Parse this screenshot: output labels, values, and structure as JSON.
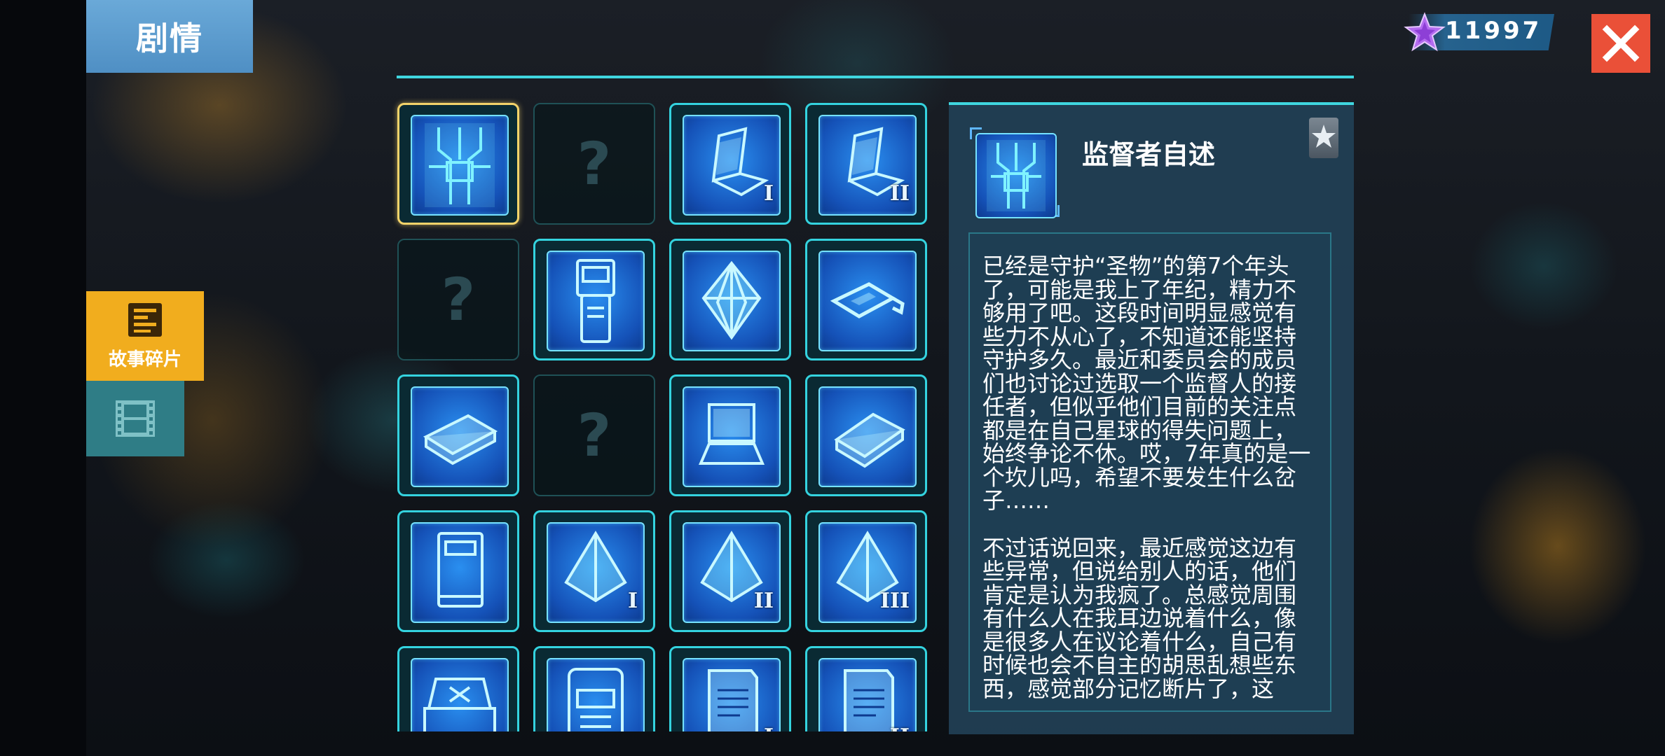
{
  "header": {
    "title": "剧情"
  },
  "sidebar": {
    "tabs": [
      {
        "label": "故事碎片",
        "icon": "document-list-icon",
        "active": true
      },
      {
        "label": "",
        "icon": "film-strip-icon",
        "active": false
      }
    ]
  },
  "currency": {
    "icon": "purple-star-icon",
    "value": "11997"
  },
  "close_button": {
    "icon": "close-icon"
  },
  "grid": {
    "items": [
      {
        "icon": "circuit-board-icon",
        "state": "selected",
        "numeral": ""
      },
      {
        "icon": "question-mark",
        "state": "locked",
        "numeral": "",
        "text": "?"
      },
      {
        "icon": "laptop-open-icon",
        "state": "unlocked",
        "numeral": "I"
      },
      {
        "icon": "laptop-open-icon",
        "state": "unlocked",
        "numeral": "II"
      },
      {
        "icon": "question-mark",
        "state": "locked",
        "numeral": "",
        "text": "?"
      },
      {
        "icon": "handheld-device-icon",
        "state": "unlocked",
        "numeral": ""
      },
      {
        "icon": "octahedron-crystal-icon",
        "state": "unlocked",
        "numeral": ""
      },
      {
        "icon": "usb-drive-icon",
        "state": "unlocked",
        "numeral": ""
      },
      {
        "icon": "book-icon",
        "state": "unlocked",
        "numeral": ""
      },
      {
        "icon": "question-mark",
        "state": "locked",
        "numeral": "",
        "text": "?"
      },
      {
        "icon": "laptop-icon",
        "state": "unlocked",
        "numeral": ""
      },
      {
        "icon": "tablet-device-icon",
        "state": "unlocked",
        "numeral": ""
      },
      {
        "icon": "notebook-icon",
        "state": "unlocked",
        "numeral": ""
      },
      {
        "icon": "pyramid-crystal-icon",
        "state": "unlocked",
        "numeral": "I"
      },
      {
        "icon": "pyramid-crystal-icon",
        "state": "unlocked",
        "numeral": "II"
      },
      {
        "icon": "pyramid-crystal-icon",
        "state": "unlocked",
        "numeral": "III"
      },
      {
        "icon": "console-device-icon",
        "state": "unlocked",
        "numeral": ""
      },
      {
        "icon": "robot-terminal-icon",
        "state": "unlocked",
        "numeral": ""
      },
      {
        "icon": "paper-document-icon",
        "state": "unlocked",
        "numeral": "I"
      },
      {
        "icon": "paper-document-icon",
        "state": "unlocked",
        "numeral": "II"
      }
    ]
  },
  "detail": {
    "icon": "circuit-board-icon",
    "badge_icon": "star-badge-icon",
    "title": "监督者自述",
    "paragraphs": [
      "已经是守护“圣物”的第7个年头了，可能是我上了年纪，精力不够用了吧。这段时间明显感觉有些力不从心了，不知道还能坚持守护多久。最近和委员会的成员们也讨论过选取一个监督人的接任者，但似乎他们目前的关注点都是在自己星球的得失问题上，始终争论不休。哎，7年真的是一个坎儿吗，希望不要发生什么岔子……",
      "不过话说回来，最近感觉这边有些异常，但说给别人的话，他们肯定是认为我疯了。总感觉周围有什么人在我耳边说着什么，像是很多人在议论着什么，自己有时候也会不自主的胡思乱想些东西，感觉部分记忆断片了，这"
    ]
  }
}
